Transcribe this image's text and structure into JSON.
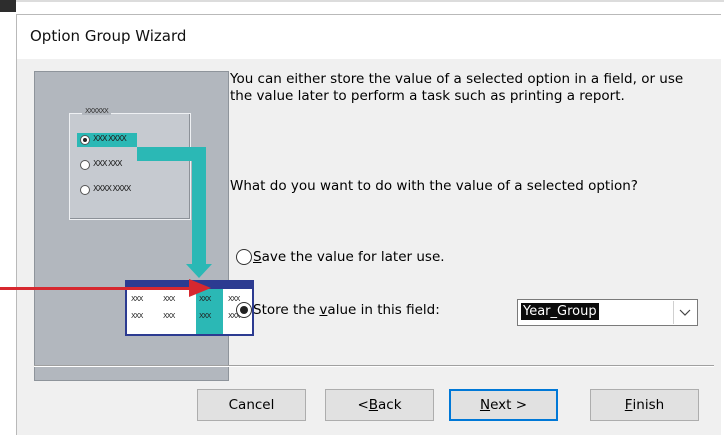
{
  "window": {
    "title": "Option Group Wizard"
  },
  "illustration": {
    "frame_label": "XXXXXX",
    "options": [
      "XXX XXXX",
      "XXX XXX",
      "XXXX XXXX"
    ],
    "table_rows": [
      [
        "XXX",
        "XXX",
        "XXX",
        "XXX"
      ],
      [
        "XXX",
        "XXX",
        "XXX",
        "XXX"
      ]
    ],
    "accent_color": "#2bb8b5",
    "table_header_color": "#2c3b91"
  },
  "instructions": {
    "description": "You can either store the value of a selected option in a field, or use the value later to perform a task such as printing a report.",
    "question": "What do you want to do with the value of a selected option?"
  },
  "options": {
    "save_for_later": {
      "accel": "S",
      "rest": "ave the value for later use.",
      "checked": false
    },
    "store_in_field": {
      "pre": "Store the ",
      "accel": "v",
      "rest": "alue in this field:",
      "checked": true
    }
  },
  "field_combo": {
    "value": "Year_Group",
    "arrow": "chevron-down-icon"
  },
  "buttons": {
    "cancel": "Cancel",
    "back_pre": "< ",
    "back_accel": "B",
    "back_rest": "ack",
    "next_accel": "N",
    "next_rest": "ext >",
    "finish_accel": "F",
    "finish_rest": "inish"
  },
  "annotation": {
    "arrow_color": "#d7282f"
  }
}
